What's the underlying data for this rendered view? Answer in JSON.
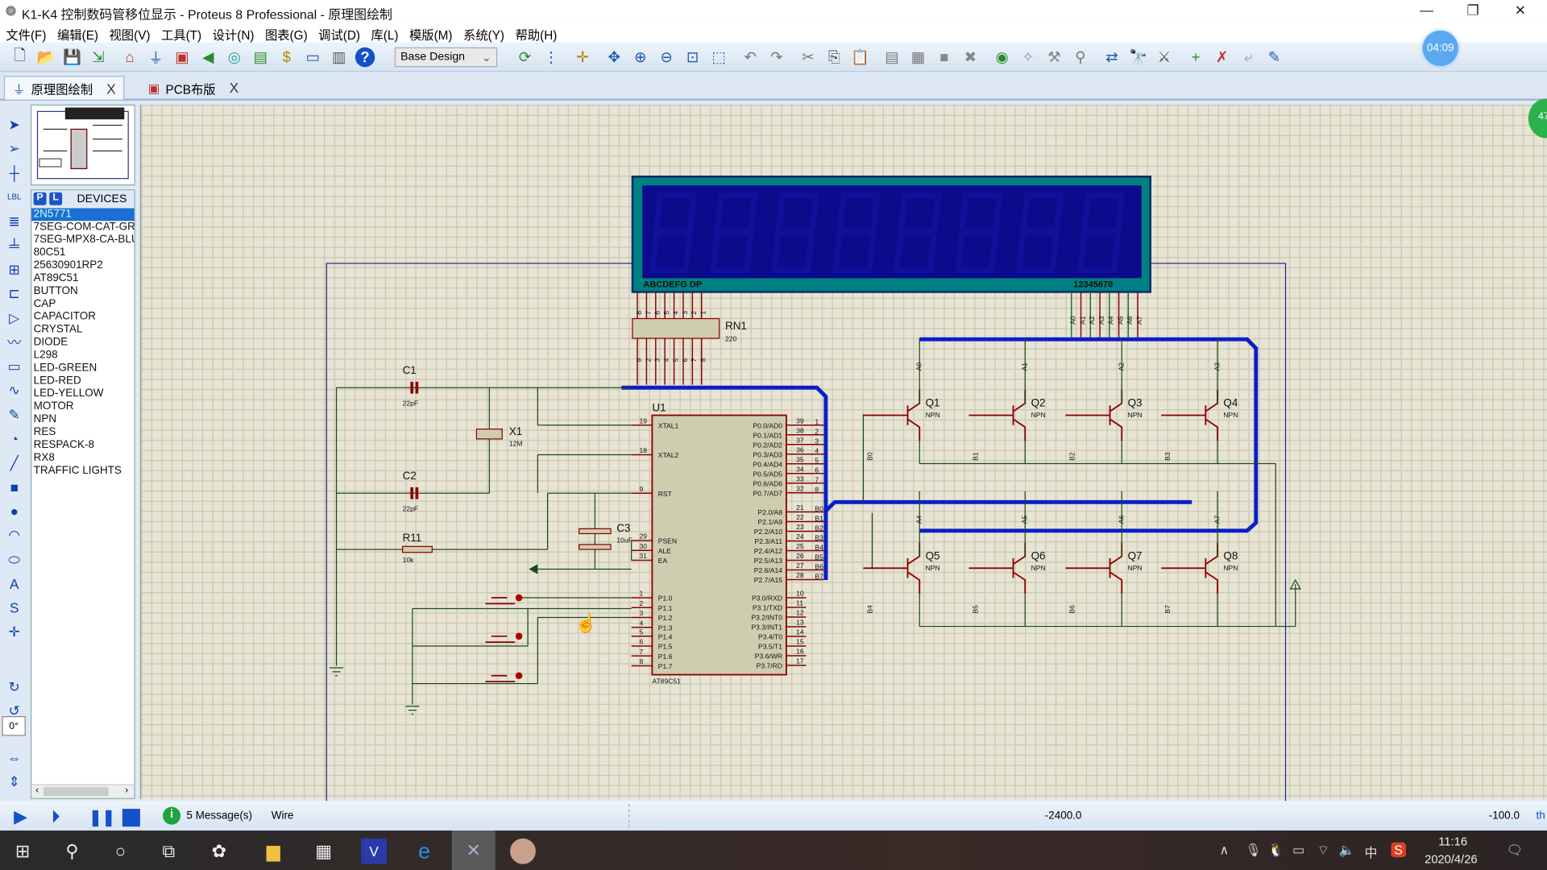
{
  "window": {
    "title": "K1-K4 控制数码管移位显示 - Proteus 8 Professional - 原理图绘制",
    "minimize": "—",
    "restore": "❐",
    "close": "✕"
  },
  "menu": [
    "文件(F)",
    "编辑(E)",
    "视图(V)",
    "工具(T)",
    "设计(N)",
    "图表(G)",
    "调试(D)",
    "库(L)",
    "模版(M)",
    "系统(Y)",
    "帮助(H)"
  ],
  "toolbar": {
    "design_select": "Base Design",
    "icons": [
      {
        "name": "new-file-icon",
        "glyph": "🗋",
        "color": "#333"
      },
      {
        "name": "open-folder-icon",
        "glyph": "📂",
        "color": "#d9a400"
      },
      {
        "name": "save-icon",
        "glyph": "💾",
        "color": "#1e5bb0"
      },
      {
        "name": "import-icon",
        "glyph": "⇲",
        "color": "#2a8a2a"
      },
      {
        "name": "home-icon",
        "glyph": "⌂",
        "color": "#c0302a"
      },
      {
        "name": "schematic-icon",
        "glyph": "⏚",
        "color": "#1e5bb0"
      },
      {
        "name": "pcb-icon",
        "glyph": "▣",
        "color": "#c0302a"
      },
      {
        "name": "gerber-icon",
        "glyph": "◀",
        "color": "#2a8a2a"
      },
      {
        "name": "3d-view-icon",
        "glyph": "◎",
        "color": "#2aa0a0"
      },
      {
        "name": "bom-icon",
        "glyph": "▤",
        "color": "#2a8a2a"
      },
      {
        "name": "cost-icon",
        "glyph": "$",
        "color": "#b08a00"
      },
      {
        "name": "source-code-icon",
        "glyph": "▭",
        "color": "#1e5bb0"
      },
      {
        "name": "notes-icon",
        "glyph": "▥",
        "color": "#555"
      },
      {
        "name": "help-icon",
        "glyph": "?",
        "color": "#fff"
      }
    ],
    "icons2": [
      {
        "name": "refresh-icon",
        "glyph": "⟳",
        "color": "#2a8a2a"
      },
      {
        "name": "grid-icon",
        "glyph": "⋮",
        "color": "#1e5bb0"
      },
      {
        "name": "origin-icon",
        "glyph": "✛",
        "color": "#b08a00"
      },
      {
        "name": "pan-icon",
        "glyph": "✥",
        "color": "#1e5bb0"
      },
      {
        "name": "zoom-in-icon",
        "glyph": "⊕",
        "color": "#1e5bb0"
      },
      {
        "name": "zoom-out-icon",
        "glyph": "⊖",
        "color": "#1e5bb0"
      },
      {
        "name": "zoom-all-icon",
        "glyph": "⊡",
        "color": "#1e5bb0"
      },
      {
        "name": "zoom-area-icon",
        "glyph": "⬚",
        "color": "#1e5bb0"
      },
      {
        "name": "undo-icon",
        "glyph": "↶",
        "color": "#777"
      },
      {
        "name": "redo-icon",
        "glyph": "↷",
        "color": "#777"
      },
      {
        "name": "cut-icon",
        "glyph": "✂",
        "color": "#777"
      },
      {
        "name": "copy-icon",
        "glyph": "⎘",
        "color": "#555"
      },
      {
        "name": "paste-icon",
        "glyph": "📋",
        "color": "#777"
      },
      {
        "name": "block-copy-icon",
        "glyph": "▤",
        "color": "#777"
      },
      {
        "name": "block-move-icon",
        "glyph": "▦",
        "color": "#777"
      },
      {
        "name": "block-rotate-icon",
        "glyph": "■",
        "color": "#888"
      },
      {
        "name": "block-delete-icon",
        "glyph": "✖",
        "color": "#888"
      },
      {
        "name": "pick-device-icon",
        "glyph": "◉",
        "color": "#2a8a2a"
      },
      {
        "name": "make-device-icon",
        "glyph": "✧",
        "color": "#999"
      },
      {
        "name": "package-tool-icon",
        "glyph": "⚒",
        "color": "#888"
      },
      {
        "name": "decompose-icon",
        "glyph": "⚲",
        "color": "#777"
      },
      {
        "name": "wire-autorouter-icon",
        "glyph": "⇄",
        "color": "#1e5bb0"
      },
      {
        "name": "search-icon",
        "glyph": "🔭",
        "color": "#1e5bb0"
      },
      {
        "name": "property-tool-icon",
        "glyph": "⚔",
        "color": "#555"
      },
      {
        "name": "new-sheet-icon",
        "glyph": "+",
        "color": "#2a8a2a"
      },
      {
        "name": "remove-sheet-icon",
        "glyph": "✗",
        "color": "#c0302a"
      },
      {
        "name": "exit-parent-icon",
        "glyph": "⤶",
        "color": "#999"
      },
      {
        "name": "netlist-icon",
        "glyph": "✎",
        "color": "#1e5bb0"
      }
    ]
  },
  "timer": "04:09",
  "side_badge": "47",
  "tabs": [
    {
      "label": "原理图绘制",
      "icon": "schematic-icon"
    },
    {
      "label": "PCB布版",
      "icon": "pcb-icon"
    }
  ],
  "tab_close": "X",
  "left_tools": [
    "selection-mode-icon",
    "component-mode-icon",
    "junction-dot-icon",
    "wire-label-icon",
    "text-script-icon",
    "bus-icon",
    "subcircuit-icon",
    "terminal-icon",
    "device-pin-icon",
    "graph-icon",
    "tape-recorder-icon",
    "generator-icon",
    "voltage-probe-icon",
    "virtual-instrument-icon",
    "line-icon",
    "box-icon",
    "circle-icon",
    "arc-icon",
    "path-icon",
    "text-icon",
    "symbol-icon",
    "marker-icon"
  ],
  "left_glyphs": [
    "➤",
    "➢",
    "┼",
    "LBL",
    "≣",
    "╧",
    "⊞",
    "⊏",
    "▷",
    "〰",
    "▭",
    "∿",
    "✎",
    "◔",
    "╱",
    "■",
    "●",
    "◠",
    "⬭",
    "A",
    "S",
    "✛"
  ],
  "rotate_value": "0°",
  "devices": {
    "p": "P",
    "l": "L",
    "title": "DEVICES",
    "selected": 0,
    "items": [
      "2N5771",
      "7SEG-COM-CAT-GRN",
      "7SEG-MPX8-CA-BLUE",
      "80C51",
      "25630901RP2",
      "AT89C51",
      "BUTTON",
      "CAP",
      "CAPACITOR",
      "CRYSTAL",
      "DIODE",
      "L298",
      "LED-GREEN",
      "LED-RED",
      "LED-YELLOW",
      "MOTOR",
      "NPN",
      "RES",
      "RESPACK-8",
      "RX8",
      "TRAFFIC LIGHTS"
    ]
  },
  "schematic": {
    "display": {
      "seg_label": "ABCDEFG DP",
      "digit_label": "12345678",
      "seg_pins": [
        "8",
        "7",
        "6",
        "5",
        "4",
        "3",
        "2",
        "1"
      ],
      "digit_nets": [
        "A0",
        "A1",
        "A2",
        "A3",
        "A4",
        "A5",
        "A6",
        "A7"
      ]
    },
    "rn1": {
      "ref": "RN1",
      "value": "220",
      "bottom_pins": [
        "9",
        "2",
        "3",
        "4",
        "5",
        "6",
        "7",
        "8"
      ]
    },
    "u1": {
      "ref": "U1",
      "part": "AT89C51",
      "left": [
        {
          "n": "19",
          "l": "XTAL1"
        },
        {
          "n": "18",
          "l": "XTAL2"
        },
        {
          "n": "9",
          "l": "RST"
        },
        {
          "n": "29",
          "l": "PSEN"
        },
        {
          "n": "30",
          "l": "ALE"
        },
        {
          "n": "31",
          "l": "EA"
        },
        {
          "n": "1",
          "l": "P1.0"
        },
        {
          "n": "2",
          "l": "P1.1"
        },
        {
          "n": "3",
          "l": "P1.2"
        },
        {
          "n": "4",
          "l": "P1.3"
        },
        {
          "n": "5",
          "l": "P1.4"
        },
        {
          "n": "6",
          "l": "P1.5"
        },
        {
          "n": "7",
          "l": "P1.6"
        },
        {
          "n": "8",
          "l": "P1.7"
        }
      ],
      "right": [
        {
          "n": "39",
          "l": "P0.0/AD0",
          "net": "1"
        },
        {
          "n": "38",
          "l": "P0.1/AD1",
          "net": "2"
        },
        {
          "n": "37",
          "l": "P0.2/AD2",
          "net": "3"
        },
        {
          "n": "36",
          "l": "P0.3/AD3",
          "net": "4"
        },
        {
          "n": "35",
          "l": "P0.4/AD4",
          "net": "5"
        },
        {
          "n": "34",
          "l": "P0.5/AD5",
          "net": "6"
        },
        {
          "n": "33",
          "l": "P0.6/AD6",
          "net": "7"
        },
        {
          "n": "32",
          "l": "P0.7/AD7",
          "net": "8"
        },
        {
          "n": "21",
          "l": "P2.0/A8",
          "net": "B0"
        },
        {
          "n": "22",
          "l": "P2.1/A9",
          "net": "B1"
        },
        {
          "n": "23",
          "l": "P2.2/A10",
          "net": "B2"
        },
        {
          "n": "24",
          "l": "P2.3/A11",
          "net": "B3"
        },
        {
          "n": "25",
          "l": "P2.4/A12",
          "net": "B4"
        },
        {
          "n": "26",
          "l": "P2.5/A13",
          "net": "B5"
        },
        {
          "n": "27",
          "l": "P2.6/A14",
          "net": "B6"
        },
        {
          "n": "28",
          "l": "P2.7/A15",
          "net": "B7"
        },
        {
          "n": "10",
          "l": "P3.0/RXD",
          "net": ""
        },
        {
          "n": "11",
          "l": "P3.1/TXD",
          "net": ""
        },
        {
          "n": "12",
          "l": "P3.2/INT0",
          "net": ""
        },
        {
          "n": "13",
          "l": "P3.3/INT1",
          "net": ""
        },
        {
          "n": "14",
          "l": "P3.4/T0",
          "net": ""
        },
        {
          "n": "15",
          "l": "P3.5/T1",
          "net": ""
        },
        {
          "n": "16",
          "l": "P3.6/WR",
          "net": ""
        },
        {
          "n": "17",
          "l": "P3.7/RD",
          "net": ""
        }
      ]
    },
    "c1": {
      "ref": "C1",
      "value": "22pF"
    },
    "c2": {
      "ref": "C2",
      "value": "22pF"
    },
    "c3": {
      "ref": "C3",
      "value": "10uF"
    },
    "x1": {
      "ref": "X1",
      "value": "12M"
    },
    "r11": {
      "ref": "R11",
      "value": "10k"
    },
    "transistors": [
      {
        "ref": "Q1",
        "type": "NPN",
        "base": "A0",
        "emit": "B0"
      },
      {
        "ref": "Q2",
        "type": "NPN",
        "base": "A1",
        "emit": "B1"
      },
      {
        "ref": "Q3",
        "type": "NPN",
        "base": "A2",
        "emit": "B2"
      },
      {
        "ref": "Q4",
        "type": "NPN",
        "base": "A3",
        "emit": "B3"
      },
      {
        "ref": "Q5",
        "type": "NPN",
        "base": "A4",
        "emit": "B4"
      },
      {
        "ref": "Q6",
        "type": "NPN",
        "base": "A5",
        "emit": "B5"
      },
      {
        "ref": "Q7",
        "type": "NPN",
        "base": "A6",
        "emit": "B6"
      },
      {
        "ref": "Q8",
        "type": "NPN",
        "base": "A7",
        "emit": "B7"
      }
    ]
  },
  "status": {
    "messages": "5 Message(s)",
    "mode": "Wire",
    "x": "-2400.0",
    "y": "-100.0",
    "unit": "th"
  },
  "taskbar": {
    "time": "11:16",
    "date": "2020/4/26",
    "ime": "中"
  },
  "colors": {
    "wire": "#8b0000",
    "bus": "#0a1ec8",
    "display_bg": "#0b0b8c",
    "display_frame": "#008080",
    "component_fill": "#cfcdb0",
    "sheet_border": "#1a2a8a",
    "grid": "#cdcab8",
    "canvas": "#e7e4d3"
  }
}
